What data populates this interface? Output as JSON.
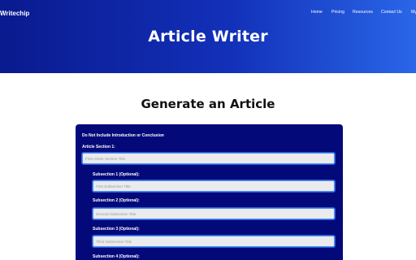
{
  "header": {
    "brand": "Writechip",
    "nav": [
      "Home",
      "Pricing",
      "Resources",
      "Contact Us",
      "My"
    ],
    "title": "Article Writer"
  },
  "main": {
    "heading": "Generate an Article"
  },
  "form": {
    "note": "Do Not Include Introduction or Conclusion",
    "section1_label": "Article Section 1:",
    "section1_placeholder": "First Article Section Title",
    "subsections": [
      {
        "label": "Subsection 1 (Optional):",
        "placeholder": "First Subsection Title"
      },
      {
        "label": "Subsection 2 (Optional):",
        "placeholder": "Second Subsection Title"
      },
      {
        "label": "Subsection 3 (Optional):",
        "placeholder": "Third Subsection Title"
      },
      {
        "label": "Subsection 4 (Optional):",
        "placeholder": ""
      }
    ]
  },
  "colors": {
    "hero_start": "#0a1a8f",
    "hero_end": "#2a66e8",
    "form_bg": "#04097a",
    "input_border": "#4a8cf0"
  }
}
